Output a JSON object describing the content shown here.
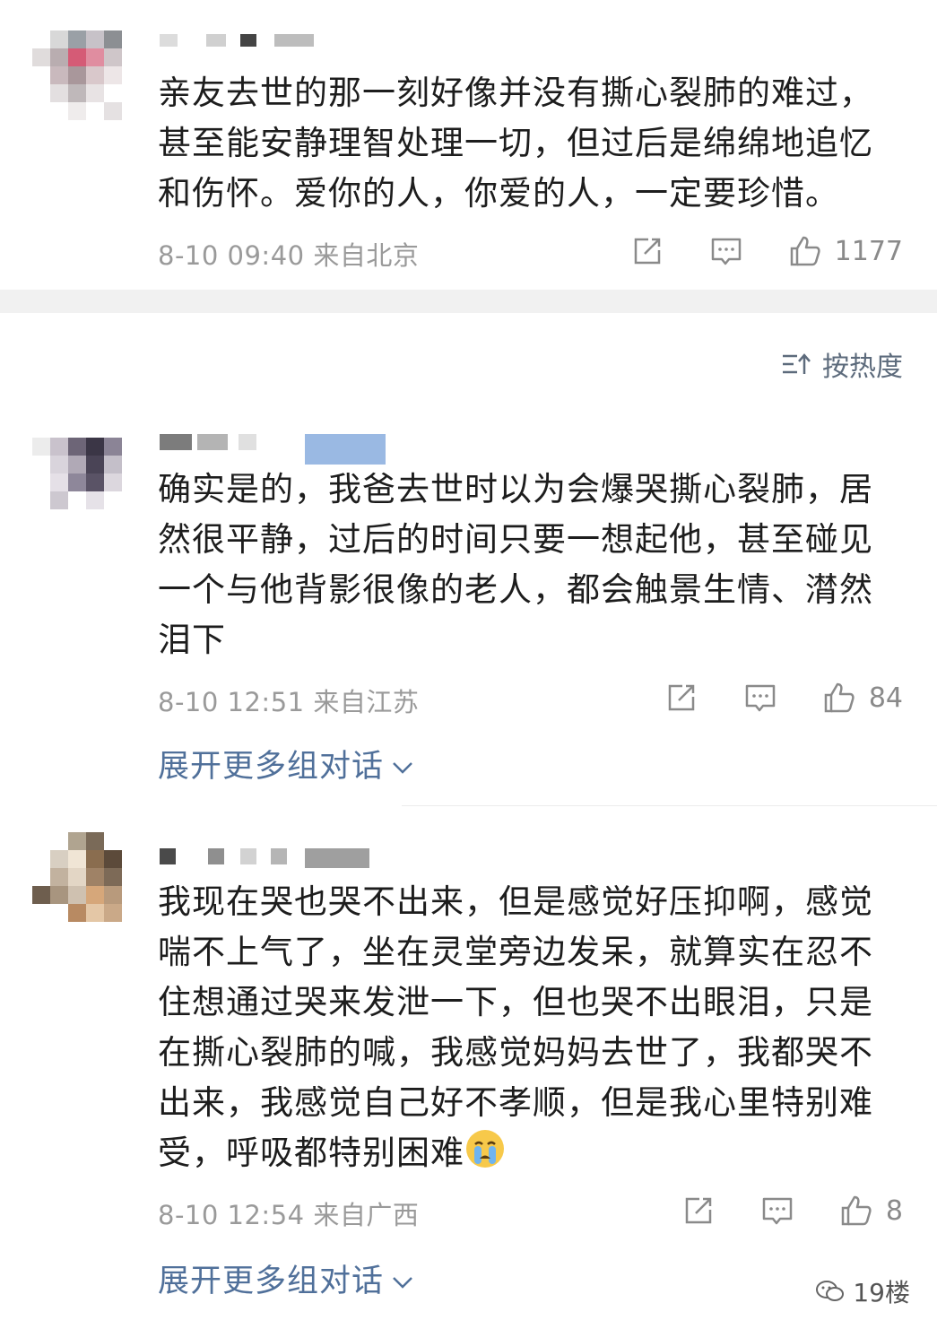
{
  "comments": [
    {
      "text": "亲友去世的那一刻好像并没有撕心裂肺的难过，甚至能安静理智处理一切，但过后是绵绵地追忆和伤怀。爱你的人，你爱的人，一定要珍惜。",
      "meta": "8-10 09:40  来自北京",
      "likes": "1177"
    },
    {
      "text": "确实是的，我爸去世时以为会爆哭撕心裂肺，居然很平静，过后的时间只要一想起他，甚至碰见一个与他背影很像的老人，都会触景生情、潸然泪下",
      "meta": "8-10 12:51  来自江苏",
      "likes": "84",
      "expand": "展开更多组对话"
    },
    {
      "text": "我现在哭也哭不出来，但是感觉好压抑啊，感觉喘不上气了，坐在灵堂旁边发呆，就算实在忍不住想通过哭来发泄一下，但也哭不出眼泪，只是在撕心裂肺的喊，我感觉妈妈去世了，我都哭不出来，我感觉自己好不孝顺，但是我心里特别难受，呼吸都特别困难",
      "meta": "8-10 12:54  来自广西",
      "likes": "8",
      "expand": "展开更多组对话"
    }
  ],
  "sort": {
    "label": "按热度"
  },
  "watermark": {
    "label": "19楼"
  },
  "colors": {
    "link": "#50709a",
    "meta": "#9a9a9a",
    "band": "#f1f1f1"
  },
  "icons": [
    "share-icon",
    "comment-icon",
    "like-icon",
    "sort-icon",
    "chevron-down-icon",
    "crying-emoji-icon",
    "wechat-icon"
  ]
}
